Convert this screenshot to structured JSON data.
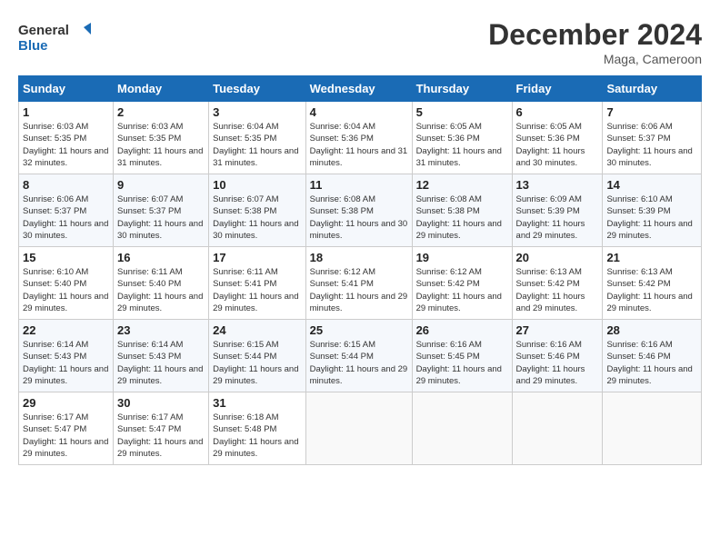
{
  "logo": {
    "line1": "General",
    "line2": "Blue"
  },
  "title": "December 2024",
  "location": "Maga, Cameroon",
  "days_of_week": [
    "Sunday",
    "Monday",
    "Tuesday",
    "Wednesday",
    "Thursday",
    "Friday",
    "Saturday"
  ],
  "weeks": [
    [
      {
        "day": "1",
        "sunrise": "6:03 AM",
        "sunset": "5:35 PM",
        "daylight": "11 hours and 32 minutes."
      },
      {
        "day": "2",
        "sunrise": "6:03 AM",
        "sunset": "5:35 PM",
        "daylight": "11 hours and 31 minutes."
      },
      {
        "day": "3",
        "sunrise": "6:04 AM",
        "sunset": "5:35 PM",
        "daylight": "11 hours and 31 minutes."
      },
      {
        "day": "4",
        "sunrise": "6:04 AM",
        "sunset": "5:36 PM",
        "daylight": "11 hours and 31 minutes."
      },
      {
        "day": "5",
        "sunrise": "6:05 AM",
        "sunset": "5:36 PM",
        "daylight": "11 hours and 31 minutes."
      },
      {
        "day": "6",
        "sunrise": "6:05 AM",
        "sunset": "5:36 PM",
        "daylight": "11 hours and 30 minutes."
      },
      {
        "day": "7",
        "sunrise": "6:06 AM",
        "sunset": "5:37 PM",
        "daylight": "11 hours and 30 minutes."
      }
    ],
    [
      {
        "day": "8",
        "sunrise": "6:06 AM",
        "sunset": "5:37 PM",
        "daylight": "11 hours and 30 minutes."
      },
      {
        "day": "9",
        "sunrise": "6:07 AM",
        "sunset": "5:37 PM",
        "daylight": "11 hours and 30 minutes."
      },
      {
        "day": "10",
        "sunrise": "6:07 AM",
        "sunset": "5:38 PM",
        "daylight": "11 hours and 30 minutes."
      },
      {
        "day": "11",
        "sunrise": "6:08 AM",
        "sunset": "5:38 PM",
        "daylight": "11 hours and 30 minutes."
      },
      {
        "day": "12",
        "sunrise": "6:08 AM",
        "sunset": "5:38 PM",
        "daylight": "11 hours and 29 minutes."
      },
      {
        "day": "13",
        "sunrise": "6:09 AM",
        "sunset": "5:39 PM",
        "daylight": "11 hours and 29 minutes."
      },
      {
        "day": "14",
        "sunrise": "6:10 AM",
        "sunset": "5:39 PM",
        "daylight": "11 hours and 29 minutes."
      }
    ],
    [
      {
        "day": "15",
        "sunrise": "6:10 AM",
        "sunset": "5:40 PM",
        "daylight": "11 hours and 29 minutes."
      },
      {
        "day": "16",
        "sunrise": "6:11 AM",
        "sunset": "5:40 PM",
        "daylight": "11 hours and 29 minutes."
      },
      {
        "day": "17",
        "sunrise": "6:11 AM",
        "sunset": "5:41 PM",
        "daylight": "11 hours and 29 minutes."
      },
      {
        "day": "18",
        "sunrise": "6:12 AM",
        "sunset": "5:41 PM",
        "daylight": "11 hours and 29 minutes."
      },
      {
        "day": "19",
        "sunrise": "6:12 AM",
        "sunset": "5:42 PM",
        "daylight": "11 hours and 29 minutes."
      },
      {
        "day": "20",
        "sunrise": "6:13 AM",
        "sunset": "5:42 PM",
        "daylight": "11 hours and 29 minutes."
      },
      {
        "day": "21",
        "sunrise": "6:13 AM",
        "sunset": "5:42 PM",
        "daylight": "11 hours and 29 minutes."
      }
    ],
    [
      {
        "day": "22",
        "sunrise": "6:14 AM",
        "sunset": "5:43 PM",
        "daylight": "11 hours and 29 minutes."
      },
      {
        "day": "23",
        "sunrise": "6:14 AM",
        "sunset": "5:43 PM",
        "daylight": "11 hours and 29 minutes."
      },
      {
        "day": "24",
        "sunrise": "6:15 AM",
        "sunset": "5:44 PM",
        "daylight": "11 hours and 29 minutes."
      },
      {
        "day": "25",
        "sunrise": "6:15 AM",
        "sunset": "5:44 PM",
        "daylight": "11 hours and 29 minutes."
      },
      {
        "day": "26",
        "sunrise": "6:16 AM",
        "sunset": "5:45 PM",
        "daylight": "11 hours and 29 minutes."
      },
      {
        "day": "27",
        "sunrise": "6:16 AM",
        "sunset": "5:46 PM",
        "daylight": "11 hours and 29 minutes."
      },
      {
        "day": "28",
        "sunrise": "6:16 AM",
        "sunset": "5:46 PM",
        "daylight": "11 hours and 29 minutes."
      }
    ],
    [
      {
        "day": "29",
        "sunrise": "6:17 AM",
        "sunset": "5:47 PM",
        "daylight": "11 hours and 29 minutes."
      },
      {
        "day": "30",
        "sunrise": "6:17 AM",
        "sunset": "5:47 PM",
        "daylight": "11 hours and 29 minutes."
      },
      {
        "day": "31",
        "sunrise": "6:18 AM",
        "sunset": "5:48 PM",
        "daylight": "11 hours and 29 minutes."
      },
      null,
      null,
      null,
      null
    ]
  ],
  "labels": {
    "sunrise_prefix": "Sunrise: ",
    "sunset_prefix": "Sunset: ",
    "daylight_prefix": "Daylight: "
  }
}
